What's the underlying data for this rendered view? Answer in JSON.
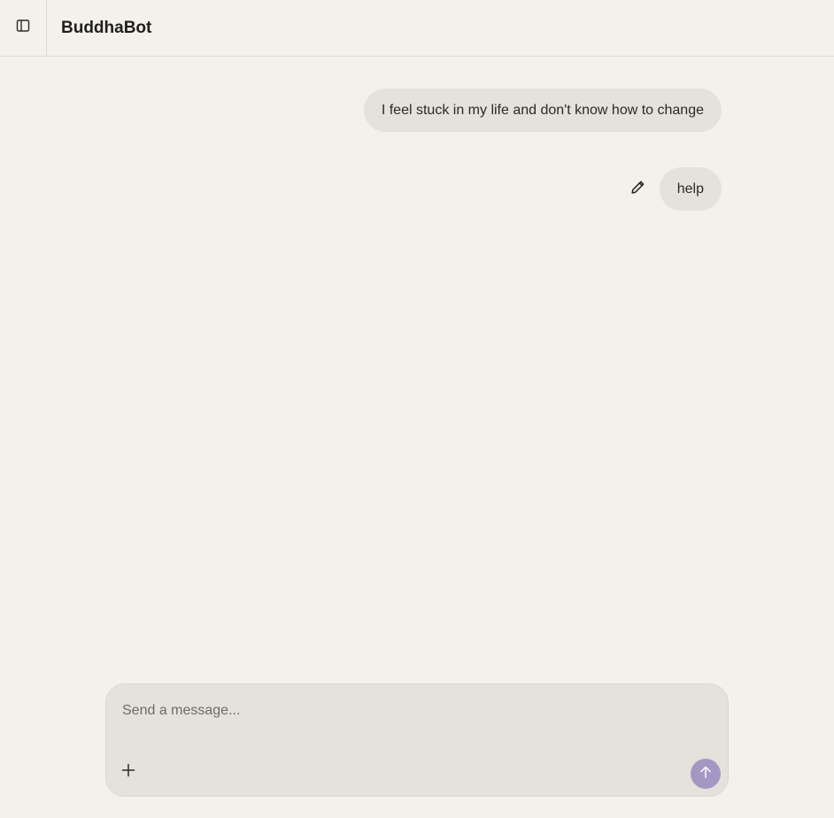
{
  "header": {
    "title": "BuddhaBot",
    "sidebar_toggle_icon": "sidebar-panel-icon"
  },
  "messages": [
    {
      "role": "user",
      "text": "I feel stuck in my life and don't know how to change"
    },
    {
      "role": "user",
      "text": "help",
      "action_icon": "pencil-edit-icon"
    }
  ],
  "composer": {
    "placeholder": "Send a message...",
    "value": "",
    "attach_icon": "plus-icon",
    "send_icon": "arrow-up-icon"
  },
  "colors": {
    "background": "#f4f1eb",
    "bubble": "#e5e1db",
    "send_button": "#a597c4"
  }
}
